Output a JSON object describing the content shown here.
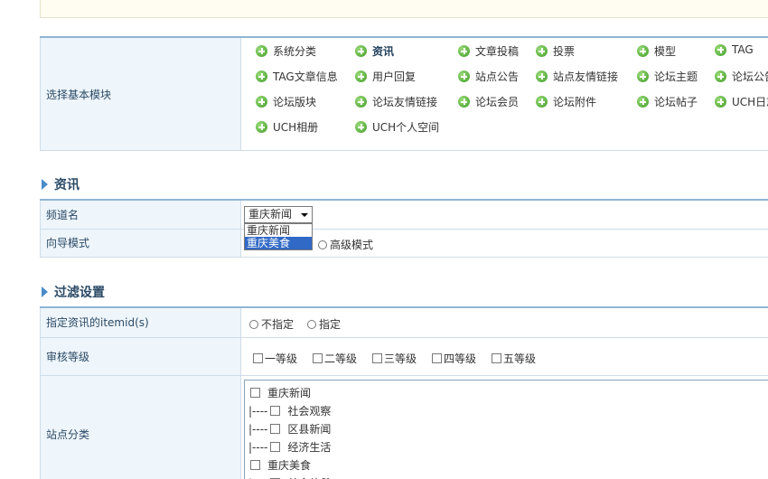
{
  "modules": {
    "label": "选择基本模块",
    "items": [
      {
        "label": "系统分类",
        "bold": false
      },
      {
        "label": "资讯",
        "bold": true
      },
      {
        "label": "文章投稿",
        "bold": false
      },
      {
        "label": "投票",
        "bold": false
      },
      {
        "label": "模型",
        "bold": false
      },
      {
        "label": "TAG",
        "bold": false
      },
      {
        "label": "TAG文章信息",
        "bold": false
      },
      {
        "label": "用户回复",
        "bold": false
      },
      {
        "label": "站点公告",
        "bold": false
      },
      {
        "label": "站点友情链接",
        "bold": false
      },
      {
        "label": "论坛主题",
        "bold": false
      },
      {
        "label": "论坛公告",
        "bold": false
      },
      {
        "label": "论坛版块",
        "bold": false
      },
      {
        "label": "论坛友情链接",
        "bold": false
      },
      {
        "label": "论坛会员",
        "bold": false
      },
      {
        "label": "论坛附件",
        "bold": false
      },
      {
        "label": "论坛帖子",
        "bold": false
      },
      {
        "label": "UCH日志",
        "bold": false
      },
      {
        "label": "UCH相册",
        "bold": false
      },
      {
        "label": "UCH个人空间",
        "bold": false
      }
    ]
  },
  "news_section": {
    "title": "资讯",
    "channel_label": "频道名",
    "channel_selected": "重庆新闻",
    "channel_options": [
      "重庆新闻",
      "重庆美食"
    ],
    "channel_highlighted": "重庆美食",
    "wizard_label": "向导模式",
    "wizard_advanced": "高级模式"
  },
  "filter_section": {
    "title": "过滤设置",
    "itemid_label": "指定资讯的itemid(s)",
    "itemid_opt_none": "不指定",
    "itemid_opt_specify": "指定",
    "audit_label": "审核等级",
    "audit_levels": [
      "一等级",
      "二等级",
      "三等级",
      "四等级",
      "五等级"
    ],
    "category_label": "站点分类",
    "categories": [
      {
        "prefix": "",
        "label": "重庆新闻"
      },
      {
        "prefix": "|----",
        "label": "社会观察"
      },
      {
        "prefix": "|----",
        "label": "区县新闻"
      },
      {
        "prefix": "|----",
        "label": "经济生活"
      },
      {
        "prefix": "",
        "label": "重庆美食"
      },
      {
        "prefix": "|----",
        "label": "美食佳肴"
      }
    ]
  }
}
